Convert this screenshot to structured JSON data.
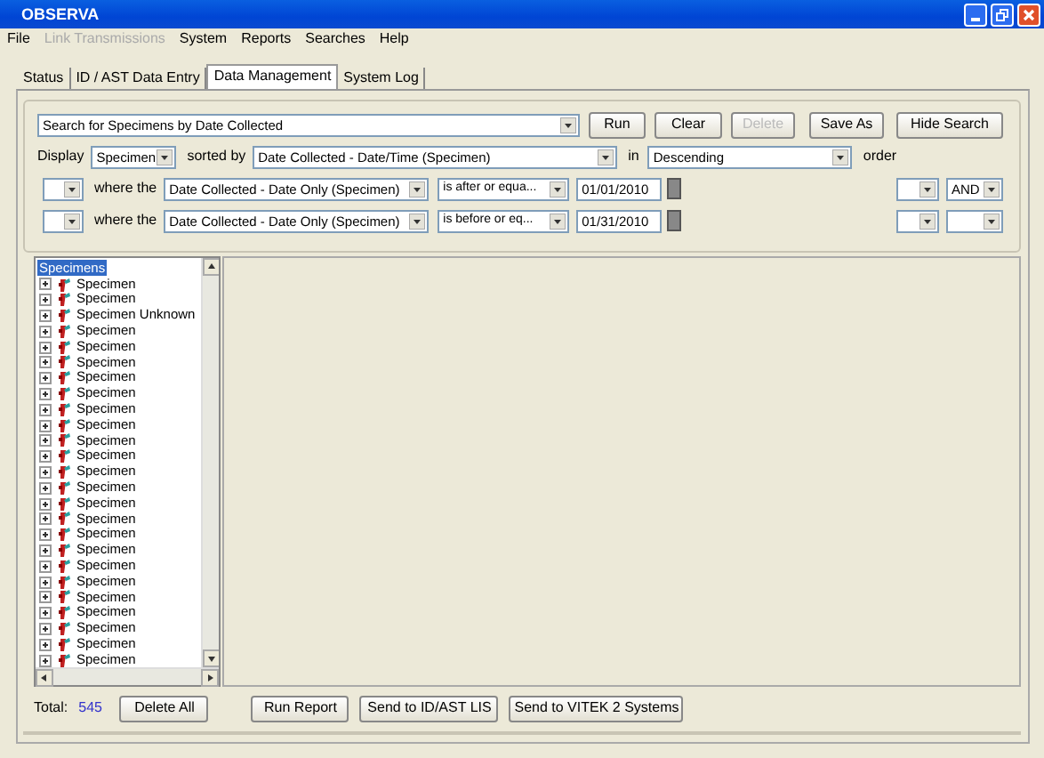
{
  "window": {
    "title": "OBSERVA"
  },
  "menu": [
    {
      "label": "File",
      "disabled": false
    },
    {
      "label": "Link Transmissions",
      "disabled": true
    },
    {
      "label": "System",
      "disabled": false
    },
    {
      "label": "Reports",
      "disabled": false
    },
    {
      "label": "Searches",
      "disabled": false
    },
    {
      "label": "Help",
      "disabled": false
    }
  ],
  "tabs": [
    {
      "label": "Status",
      "selected": false
    },
    {
      "label": "ID / AST Data Entry",
      "selected": false
    },
    {
      "label": "Data Management",
      "selected": true
    },
    {
      "label": "System Log",
      "selected": false
    }
  ],
  "search": {
    "name": "Search for Specimens by Date Collected",
    "buttons": [
      {
        "label": "Run",
        "disabled": false
      },
      {
        "label": "Clear",
        "disabled": false
      },
      {
        "label": "Delete",
        "disabled": true
      },
      {
        "label": "Save As",
        "disabled": false
      },
      {
        "label": "Hide Search",
        "disabled": false
      }
    ],
    "display_label": "Display",
    "display": "Specimen",
    "sorted_by_label": "sorted by",
    "sorted_by": "Date Collected - Date/Time (Specimen)",
    "in_label": "in",
    "direction": "Descending",
    "order_label": "order",
    "criteria": [
      {
        "where_label": "where the",
        "field": "Date Collected - Date Only (Specimen)",
        "operator": "is after or equa...",
        "value": "01/01/2010",
        "logic": "AND"
      },
      {
        "where_label": "where the",
        "field": "Date Collected - Date Only (Specimen)",
        "operator": "is before or eq...",
        "value": "01/31/2010"
      }
    ]
  },
  "tree": {
    "label": "Specimens",
    "selected": true,
    "children": [
      {
        "label": "Specimen",
        "expanded": false
      },
      {
        "label": "Specimen",
        "expanded": false
      },
      {
        "label": "Specimen Unknown",
        "expanded": false
      },
      {
        "label": "Specimen",
        "expanded": false
      },
      {
        "label": "Specimen",
        "expanded": false
      },
      {
        "label": "Specimen",
        "expanded": false
      },
      {
        "label": "Specimen",
        "expanded": false
      },
      {
        "label": "Specimen",
        "expanded": false
      },
      {
        "label": "Specimen",
        "expanded": false
      },
      {
        "label": "Specimen",
        "expanded": false
      },
      {
        "label": "Specimen",
        "expanded": false
      },
      {
        "label": "Specimen",
        "expanded": false
      },
      {
        "label": "Specimen",
        "expanded": false
      },
      {
        "label": "Specimen",
        "expanded": false
      },
      {
        "label": "Specimen",
        "expanded": false
      },
      {
        "label": "Specimen",
        "expanded": false
      },
      {
        "label": "Specimen",
        "expanded": false
      },
      {
        "label": "Specimen",
        "expanded": false
      },
      {
        "label": "Specimen",
        "expanded": false
      },
      {
        "label": "Specimen",
        "expanded": false
      },
      {
        "label": "Specimen",
        "expanded": false
      },
      {
        "label": "Specimen",
        "expanded": false
      },
      {
        "label": "Specimen",
        "expanded": false
      },
      {
        "label": "Specimen",
        "expanded": false
      },
      {
        "label": "Specimen",
        "expanded": false
      }
    ]
  },
  "footer": {
    "total_label": "Total:",
    "total": "545",
    "buttons": [
      {
        "label": "Delete All"
      },
      {
        "label": "Run Report"
      },
      {
        "label": "Send to ID/AST LIS"
      },
      {
        "label": "Send to VITEK 2 Systems"
      }
    ]
  }
}
